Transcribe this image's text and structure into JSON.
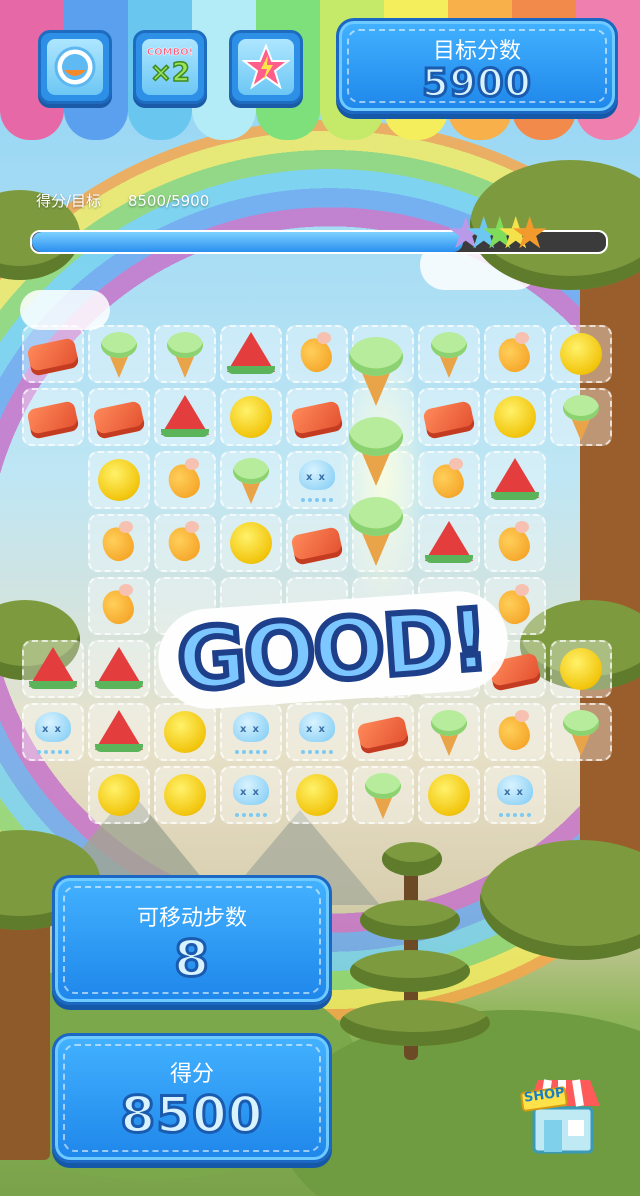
{
  "hud": {
    "target_label": "目标分数",
    "target_value": "5900",
    "moves_label": "可移动步数",
    "moves_value": "8",
    "score_label": "得分",
    "score_value": "8500"
  },
  "tools": [
    {
      "name": "bomb-tool",
      "icon": "bomb-icon"
    },
    {
      "name": "combo-tool",
      "icon": "combo-x2-icon",
      "badge": "COMBO!",
      "multiplier": "×2"
    },
    {
      "name": "star-tool",
      "icon": "lightning-star-icon"
    }
  ],
  "progress": {
    "label": "得分/目标",
    "value_text": "8500/5900",
    "fill_fraction": 0.75
  },
  "popup": {
    "text": "GOOD!"
  },
  "shop": {
    "label": "SHOP"
  },
  "board": {
    "rows": [
      [
        "salmon",
        "icecream",
        "icecream",
        "watermelon",
        "chicken",
        "",
        "icecream",
        "chicken",
        "pompom"
      ],
      [
        "salmon",
        "salmon",
        "watermelon",
        "pompom",
        "salmon",
        "",
        "salmon",
        "pompom",
        "icecream"
      ],
      [
        "",
        "pompom",
        "chicken",
        "icecream",
        "jelly",
        "",
        "chicken",
        "watermelon",
        ""
      ],
      [
        "",
        "chicken",
        "chicken",
        "pompom",
        "salmon",
        "",
        "watermelon",
        "chicken",
        ""
      ],
      [
        "",
        "chicken",
        "",
        "",
        "",
        "",
        "",
        "chicken",
        ""
      ],
      [
        "watermelon",
        "watermelon",
        "",
        "",
        "",
        "",
        "",
        "salmon",
        "pompom"
      ],
      [
        "jelly",
        "watermelon",
        "pompom",
        "jelly",
        "jelly",
        "salmon",
        "icecream",
        "chicken",
        "icecream"
      ],
      [
        "",
        "pompom",
        "pompom",
        "jelly",
        "pompom",
        "icecream",
        "pompom",
        "jelly",
        ""
      ]
    ]
  },
  "colors": {
    "awning": [
      "#e768a6",
      "#5aa0ef",
      "#69c7ef",
      "#b3ecf6",
      "#7ee07a",
      "#c5ea6a",
      "#f5ee5c",
      "#f7b04a",
      "#f18a4a",
      "#ef7fae"
    ],
    "panel": "#2e95ef"
  }
}
